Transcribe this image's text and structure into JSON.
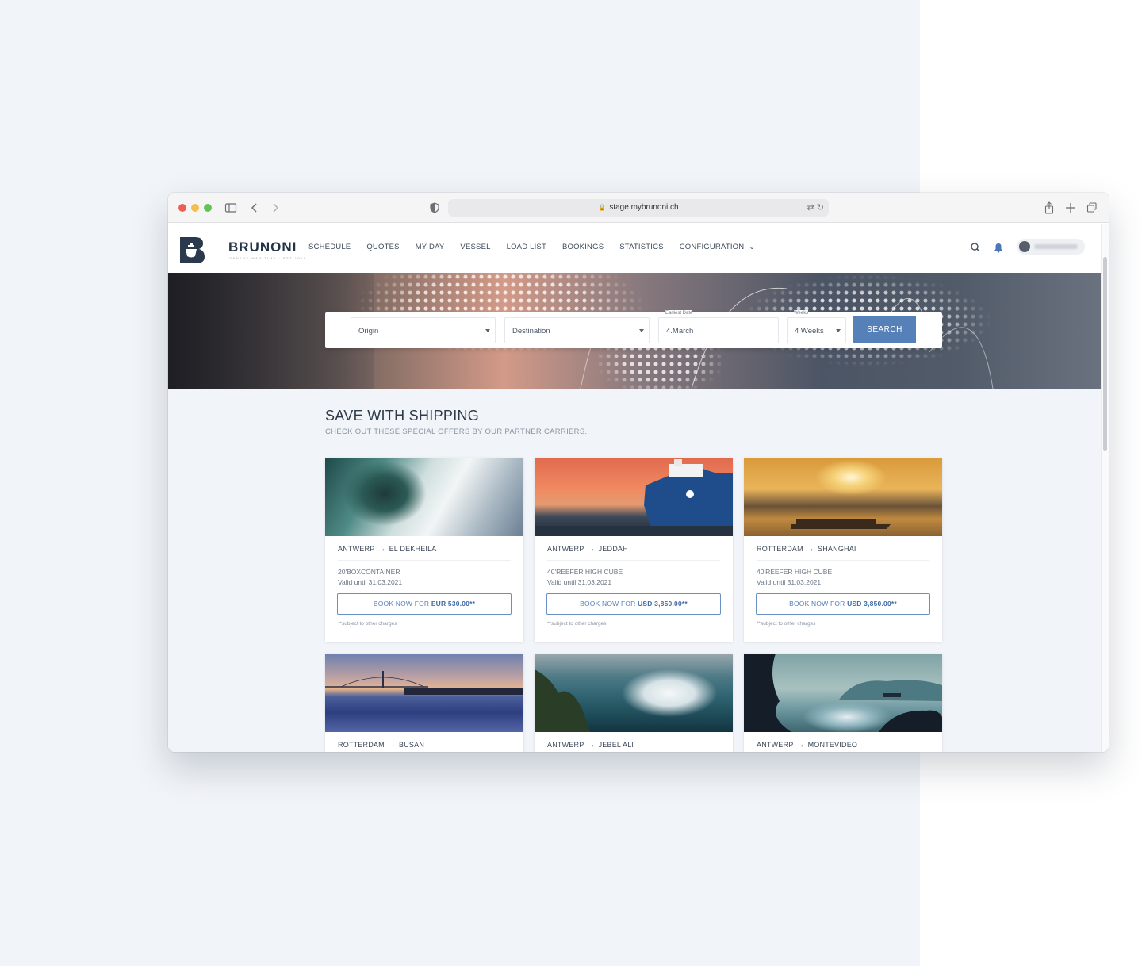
{
  "browser": {
    "url": "stage.mybrunoni.ch"
  },
  "navbar": {
    "brand": "BRUNONI",
    "brand_sub": "GENEVE MARITIME · EST 1919",
    "items": [
      {
        "label": "SCHEDULE"
      },
      {
        "label": "QUOTES"
      },
      {
        "label": "MY DAY"
      },
      {
        "label": "VESSEL"
      },
      {
        "label": "LOAD LIST"
      },
      {
        "label": "BOOKINGS"
      },
      {
        "label": "STATISTICS"
      },
      {
        "label": "CONFIGURATION"
      }
    ]
  },
  "search": {
    "origin": "Origin",
    "destination": "Destination",
    "earliest_date_label": "Earliest Date",
    "earliest_date": "4.March",
    "weeks_label": "Weeks",
    "weeks": "4 Weeks",
    "button": "SEARCH"
  },
  "offers": {
    "title": "SAVE WITH SHIPPING",
    "subtitle": "CHECK OUT THESE SPECIAL OFFERS BY OUR PARTNER CARRIERS.",
    "cards": [
      {
        "from": "ANTWERP",
        "to": "EL DEKHEILA",
        "container": "20'BOXCONTAINER",
        "valid": "Valid until 31.03.2021",
        "book_prefix": "BOOK NOW FOR ",
        "price": "EUR 530.00**",
        "note": "**subject to other charges"
      },
      {
        "from": "ANTWERP",
        "to": "JEDDAH",
        "container": "40'REEFER HIGH CUBE",
        "valid": "Valid until 31.03.2021",
        "book_prefix": "BOOK NOW FOR ",
        "price": "USD 3,850.00**",
        "note": "**subject to other charges"
      },
      {
        "from": "ROTTERDAM",
        "to": "SHANGHAI",
        "container": "40'REEFER HIGH CUBE",
        "valid": "Valid until 31.03.2021",
        "book_prefix": "BOOK NOW FOR ",
        "price": "USD 3,850.00**",
        "note": "**subject to other charges"
      },
      {
        "from": "ROTTERDAM",
        "to": "BUSAN"
      },
      {
        "from": "ANTWERP",
        "to": "JEBEL ALI"
      },
      {
        "from": "ANTWERP",
        "to": "MONTEVIDEO"
      }
    ]
  },
  "colors": {
    "accent": "#5680b8",
    "brand": "#243447",
    "background": "#f1f4f8"
  }
}
